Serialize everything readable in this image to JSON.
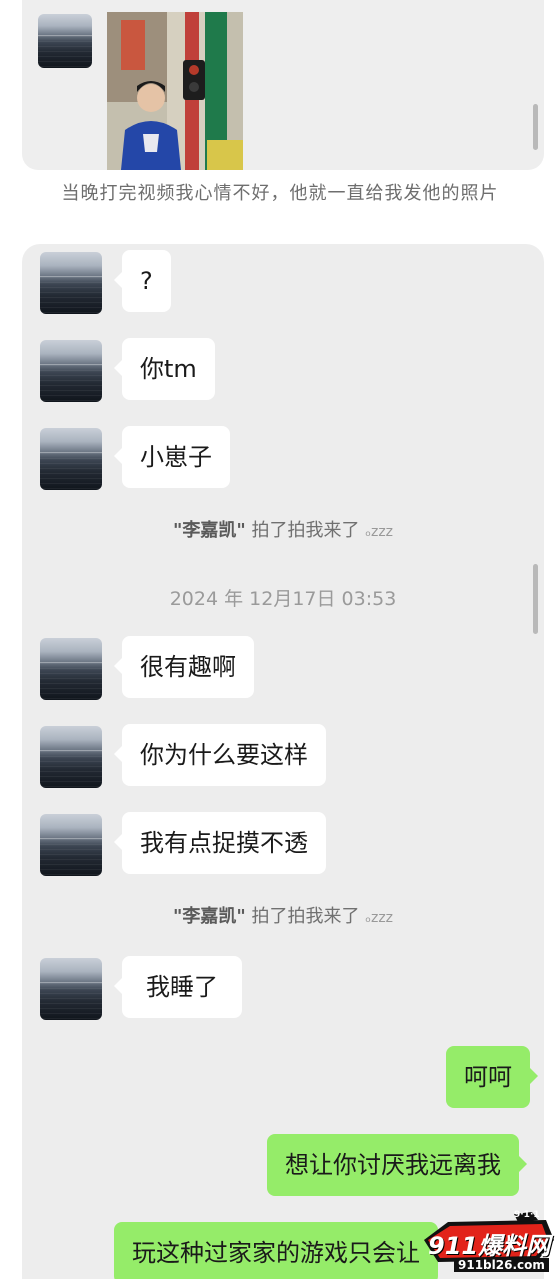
{
  "caption": "当晚打完视频我心情不好，他就一直给我发他的照片",
  "messages": [
    {
      "text": "?"
    },
    {
      "text": "你tm"
    },
    {
      "text": "小崽子"
    },
    {
      "text": "很有趣啊"
    },
    {
      "text": "你为什么要这样"
    },
    {
      "text": "我有点捉摸不透"
    },
    {
      "text": "我睡了"
    },
    {
      "text": "呵呵"
    },
    {
      "text": "想让你讨厌我远离我"
    },
    {
      "text": "玩这种过家家的游戏只会让"
    }
  ],
  "system_msgs": [
    {
      "name": "\"李嘉凯\"",
      "action": " 拍了拍我来了",
      "suffix": "💤"
    },
    {
      "name": "\"李嘉凯\"",
      "action": " 拍了拍我来了",
      "suffix": "💤"
    }
  ],
  "timestamp": "2024 年 12月17日 03:53",
  "watermark": {
    "main": "911爆料网",
    "badge": "9·1·1",
    "url": "911bl26.com"
  },
  "colors": {
    "incoming_bubble": "#ffffff",
    "outgoing_bubble": "#95ec69",
    "chat_bg": "#ededed",
    "watermark_red": "#e2231a"
  }
}
